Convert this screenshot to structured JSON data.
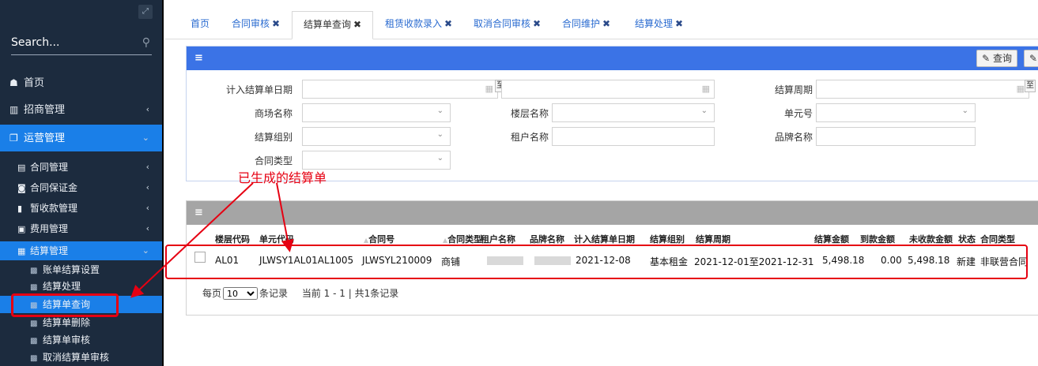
{
  "sidebar": {
    "search_placeholder": "Search...",
    "home": "首页",
    "merchant": "招商管理",
    "operation": "运营管理",
    "sub": [
      "合同管理",
      "合同保证金",
      "暂收款管理",
      "费用管理",
      "结算管理"
    ],
    "leaves": [
      "账单结算设置",
      "结算处理",
      "结算单查询",
      "结算单删除",
      "结算单审核",
      "取消结算单审核"
    ]
  },
  "tabs": [
    {
      "label": "首页",
      "closable": false
    },
    {
      "label": "合同审核",
      "closable": true
    },
    {
      "label": "结算单查询",
      "closable": true,
      "active": true
    },
    {
      "label": "租赁收款录入",
      "closable": true
    },
    {
      "label": "取消合同审核",
      "closable": true
    },
    {
      "label": "合同维护",
      "closable": true
    },
    {
      "label": "结算处理",
      "closable": true
    }
  ],
  "toolbar": {
    "query": "查询"
  },
  "filters": {
    "settle_date": "计入结算单日期",
    "to": "至",
    "period": "结算周期",
    "mall": "商场名称",
    "floor": "楼层名称",
    "unit": "单元号",
    "group": "结算组别",
    "tenant": "租户名称",
    "brand": "品牌名称",
    "contract_type": "合同类型"
  },
  "annotation": "已生成的结算单",
  "table": {
    "headers": [
      "楼层代码",
      "单元代码",
      "合同号",
      "合同类型",
      "租户名称",
      "品牌名称",
      "计入结算单日期",
      "结算组别",
      "结算周期",
      "结算金额",
      "到款金额",
      "未收款金额",
      "状态",
      "合同类型"
    ],
    "row": {
      "floor": "AL01",
      "unit": "JLWSY1AL01AL1005",
      "contract": "JLWSYL210009",
      "ctype": "商铺",
      "date": "2021-12-08",
      "group": "基本租金",
      "period": "2021-12-01至2021-12-31",
      "amount": "5,498.18",
      "received": "0.00",
      "unpaid": "5,498.18",
      "status": "新建",
      "ctype2": "非联营合同"
    }
  },
  "pager": {
    "prefix": "每页",
    "size": "10",
    "suffix": "条记录",
    "info": "当前 1 - 1 | 共1条记录"
  }
}
